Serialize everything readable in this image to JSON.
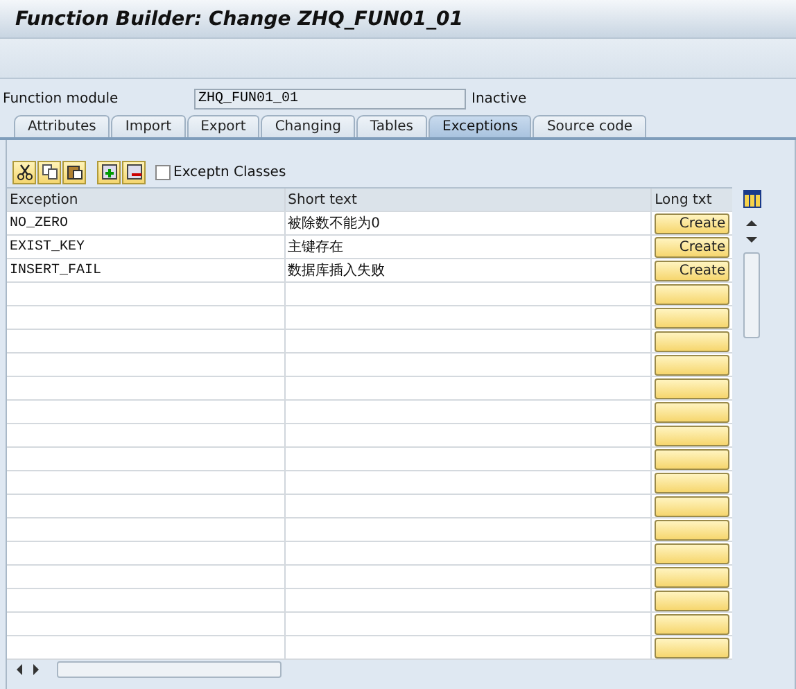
{
  "window": {
    "title": "Function Builder: Change ZHQ_FUN01_01"
  },
  "function_module": {
    "label": "Function module",
    "value": "ZHQ_FUN01_01",
    "status": "Inactive"
  },
  "tabs": [
    {
      "label": "Attributes",
      "selected": false
    },
    {
      "label": "Import",
      "selected": false
    },
    {
      "label": "Export",
      "selected": false
    },
    {
      "label": "Changing",
      "selected": false
    },
    {
      "label": "Tables",
      "selected": false
    },
    {
      "label": "Exceptions",
      "selected": true
    },
    {
      "label": "Source code",
      "selected": false
    }
  ],
  "exception_classes": {
    "label": "Exceptn Classes",
    "checked": false
  },
  "table": {
    "columns": [
      "Exception",
      "Short text",
      "Long txt"
    ],
    "rows": [
      {
        "exception": "NO_ZERO",
        "short_text": "被除数不能为0",
        "long_text": "Create"
      },
      {
        "exception": "EXIST_KEY",
        "short_text": "主键存在",
        "long_text": "Create"
      },
      {
        "exception": "INSERT_FAIL",
        "short_text": "数据库插入失败",
        "long_text": "Create"
      }
    ]
  }
}
